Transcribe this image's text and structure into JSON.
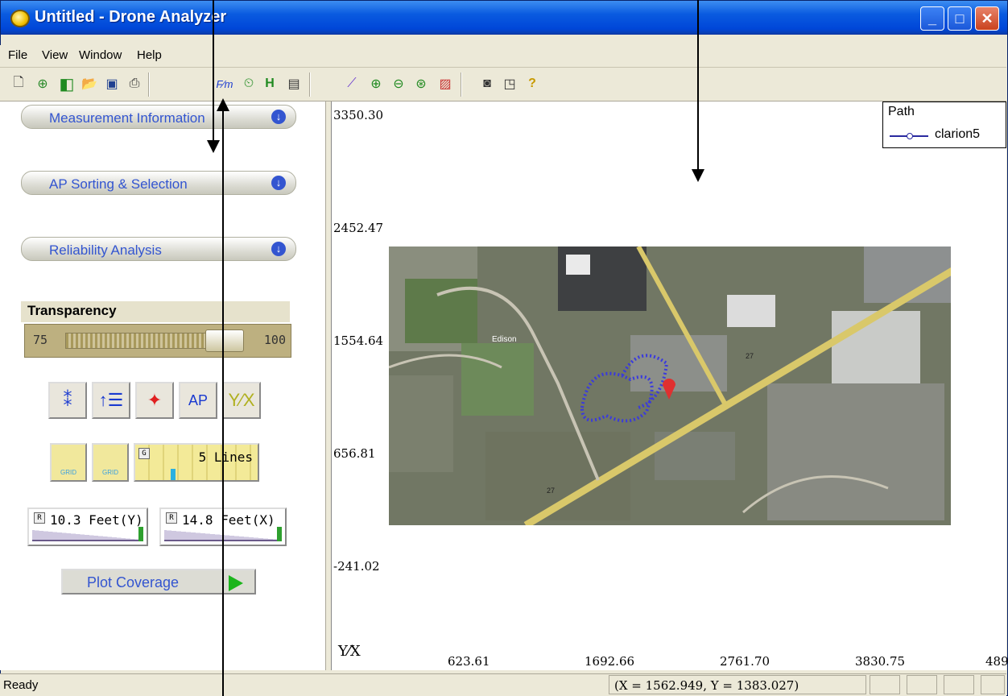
{
  "window": {
    "title": "Untitled - Drone Analyzer"
  },
  "menu": [
    "File",
    "View",
    "Window",
    "Help"
  ],
  "toolbar": {
    "icons": [
      "new-icon",
      "open-map-icon",
      "split-view-icon",
      "open-folder-icon",
      "save-icon",
      "print-icon",
      "formula-icon",
      "timer-icon",
      "binoculars-icon",
      "panel-icon",
      "ruler-icon",
      "zoom-in-icon",
      "zoom-out-icon",
      "zoom-fit-icon",
      "image-icon",
      "frame-icon",
      "window-icon",
      "help-icon"
    ]
  },
  "sidebar": {
    "sections": [
      "Measurement Information",
      "AP Sorting & Selection",
      "Reliability Analysis"
    ],
    "transparency": {
      "label": "Transparency",
      "min": "75",
      "max": "100",
      "value_fraction": 0.85
    },
    "grid_label": "GRID",
    "lines_label": "5 Lines",
    "res_y": "10.3 Feet(Y)",
    "res_x": "14.8 Feet(X)",
    "plot_button": "Plot Coverage"
  },
  "plot": {
    "y_ticks": [
      "3350.30",
      "2452.47",
      "1554.64",
      "656.81",
      "-241.02"
    ],
    "x_ticks": [
      "623.61",
      "1692.66",
      "2761.70",
      "3830.75",
      "489"
    ],
    "corner_label": "Y⁄X",
    "legend_title": "Path",
    "legend_series": "clarion5"
  },
  "map_labels": [
    "Edison",
    "27"
  ],
  "status": {
    "text": "Ready",
    "coords": "(X = 1562.949, Y = 1383.027)"
  }
}
